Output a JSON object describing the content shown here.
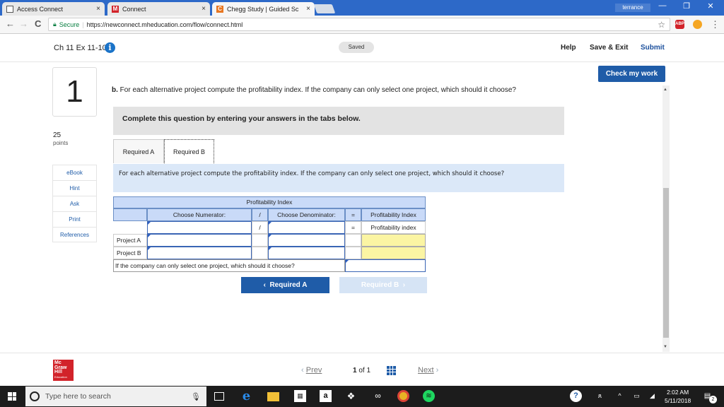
{
  "browser": {
    "tabs": [
      {
        "label": "Access Connect",
        "close": "×"
      },
      {
        "label": "Connect",
        "close": "×"
      },
      {
        "label": "Chegg Study | Guided Sc",
        "close": "×"
      }
    ],
    "profile": "terrance",
    "window_controls": {
      "minimize": "—",
      "restore": "❐",
      "close": "✕"
    },
    "nav": {
      "back": "←",
      "forward": "→",
      "reload": "C"
    },
    "secure_label": "Secure",
    "url": "https://newconnect.mheducation.com/flow/connect.html",
    "star": "☆",
    "ext_abp": "ABP",
    "menu": "⋮"
  },
  "app": {
    "title": "Ch 11 Ex 11-10",
    "info": "i",
    "status": "Saved",
    "help": "Help",
    "save_exit": "Save & Exit",
    "submit": "Submit",
    "check_work": "Check my work"
  },
  "question": {
    "number": "1",
    "points_value": "25",
    "points_label": "points",
    "side_nav": [
      "eBook",
      "Hint",
      "Ask",
      "Print",
      "References"
    ],
    "part_label": "b.",
    "text": "For each alternative project compute the profitability index. If the company can only select one project, which should it choose?",
    "instruction": "Complete this question by entering your answers in the tabs below.",
    "tabs": [
      "Required A",
      "Required B"
    ],
    "prompt": "For each alternative project compute the profitability index. If the company can only select one project, which should it choose?"
  },
  "table": {
    "title": "Profitability Index",
    "headers": {
      "numerator": "Choose Numerator:",
      "div": "/",
      "denominator": "Choose Denominator:",
      "eq": "=",
      "result": "Profitability Index"
    },
    "formula_row": {
      "div": "/",
      "eq": "=",
      "result": "Profitability index"
    },
    "rows": [
      "Project A",
      "Project B"
    ],
    "choose_label": "If the company can only select one project, which should it choose?"
  },
  "nav_buttons": {
    "prev": "Required A",
    "next": "Required B"
  },
  "pagination": {
    "prev": "Prev",
    "current": "1",
    "of": "of",
    "total": "1",
    "next": "Next"
  },
  "logo": {
    "lines": [
      "Mc",
      "Graw",
      "Hill"
    ],
    "sub": "Education"
  },
  "taskbar": {
    "search_placeholder": "Type here to search",
    "time": "2:02 AM",
    "date": "5/11/2018",
    "notifications": "2"
  },
  "colors": {
    "primary": "#1f5ca8",
    "header_blue": "#c9daf8",
    "result_yellow": "#fbf5a3",
    "taskbar": "#1c1c1c"
  }
}
